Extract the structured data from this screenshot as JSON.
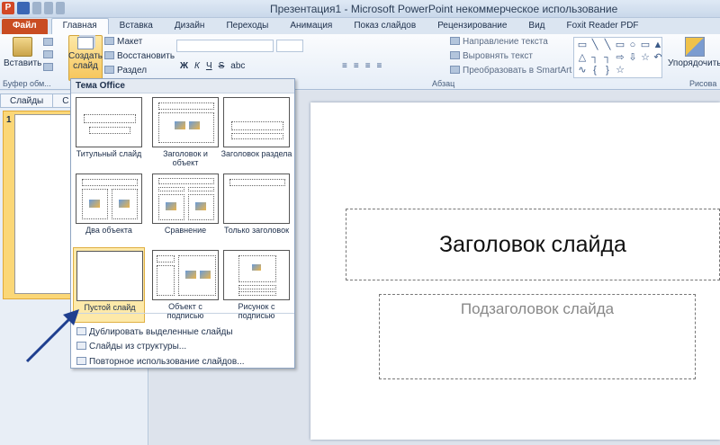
{
  "window": {
    "title": "Презентация1  -  Microsoft PowerPoint некоммерческое использование",
    "app_icon_letter": "P"
  },
  "tabs": [
    {
      "label": "Файл"
    },
    {
      "label": "Главная"
    },
    {
      "label": "Вставка"
    },
    {
      "label": "Дизайн"
    },
    {
      "label": "Переходы"
    },
    {
      "label": "Анимация"
    },
    {
      "label": "Показ слайдов"
    },
    {
      "label": "Рецензирование"
    },
    {
      "label": "Вид"
    },
    {
      "label": "Foxit Reader PDF"
    }
  ],
  "ribbon": {
    "paste_label": "Вставить",
    "clipboard_group": "Буфер обм...",
    "new_slide_label_1": "Создать",
    "new_slide_label_2": "слайд",
    "layout_label": "Макет",
    "reset_label": "Восстановить",
    "section_label": "Раздел",
    "paragraph_group": "Абзац",
    "text_direction": "Направление текста",
    "align_text": "Выровнять текст",
    "convert_smartart": "Преобразовать в SmartArt",
    "arrange_label": "Упорядочить",
    "drawing_group": "Рисова",
    "format_bold": "Ж",
    "format_italic": "К",
    "format_underline": "Ч",
    "format_strike": "S",
    "format_abc": "abc"
  },
  "left_pane": {
    "tab_slides": "Слайды",
    "tab_outline": "С",
    "slide_number": "1"
  },
  "slide": {
    "title_placeholder": "Заголовок слайда",
    "subtitle_placeholder": "Подзаголовок слайда"
  },
  "dropdown": {
    "header": "Тема Office",
    "layouts": [
      {
        "label": "Титульный слайд"
      },
      {
        "label": "Заголовок и объект"
      },
      {
        "label": "Заголовок раздела"
      },
      {
        "label": "Два объекта"
      },
      {
        "label": "Сравнение"
      },
      {
        "label": "Только заголовок"
      },
      {
        "label": "Пустой слайд"
      },
      {
        "label": "Объект с подписью"
      },
      {
        "label": "Рисунок с подписью"
      }
    ],
    "commands": [
      {
        "label": "Дублировать выделенные слайды"
      },
      {
        "label": "Слайды из структуры..."
      },
      {
        "label": "Повторное использование слайдов..."
      }
    ]
  },
  "colors": {
    "file_tab": "#c94c22",
    "selection": "#fde9a9",
    "arrow": "#1f3f8f"
  }
}
